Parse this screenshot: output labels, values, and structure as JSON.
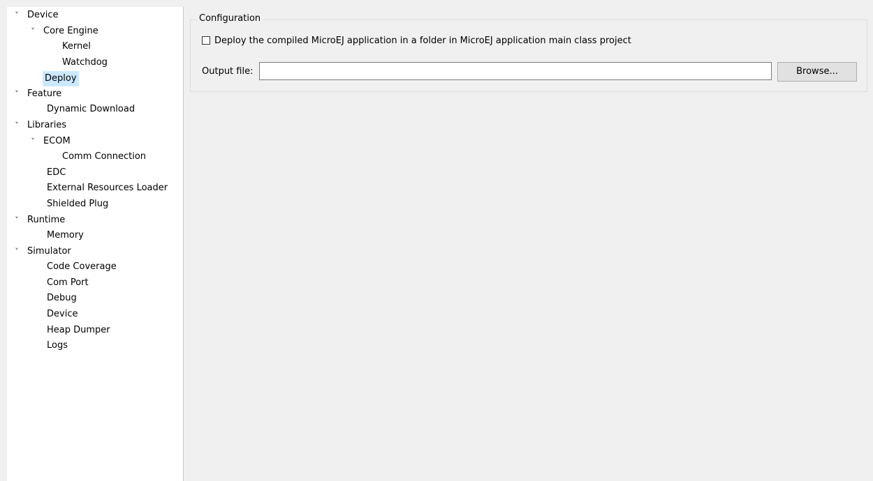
{
  "tree": {
    "items": [
      {
        "label": "Device",
        "chevron": "˅"
      },
      {
        "label": "Core Engine",
        "chevron": "˅"
      },
      {
        "label": "Kernel",
        "chevron": ""
      },
      {
        "label": "Watchdog",
        "chevron": ""
      },
      {
        "label": "Deploy",
        "chevron": ""
      },
      {
        "label": "Feature",
        "chevron": "˅"
      },
      {
        "label": "Dynamic Download",
        "chevron": ""
      },
      {
        "label": "Libraries",
        "chevron": "˅"
      },
      {
        "label": "ECOM",
        "chevron": "˅"
      },
      {
        "label": "Comm Connection",
        "chevron": ""
      },
      {
        "label": "EDC",
        "chevron": ""
      },
      {
        "label": "External Resources Loader",
        "chevron": ""
      },
      {
        "label": "Shielded Plug",
        "chevron": ""
      },
      {
        "label": "Runtime",
        "chevron": "˅"
      },
      {
        "label": "Memory",
        "chevron": ""
      },
      {
        "label": "Simulator",
        "chevron": "˅"
      },
      {
        "label": "Code Coverage",
        "chevron": ""
      },
      {
        "label": "Com Port",
        "chevron": ""
      },
      {
        "label": "Debug",
        "chevron": ""
      },
      {
        "label": "Device",
        "chevron": ""
      },
      {
        "label": "Heap Dumper",
        "chevron": ""
      },
      {
        "label": "Logs",
        "chevron": ""
      }
    ],
    "selected": "Deploy",
    "selection_color": "#cce8ff"
  },
  "config": {
    "group_title": "Configuration",
    "checkbox_label": "Deploy the compiled MicroEJ application in a folder in MicroEJ application main class project",
    "checkbox_checked": false,
    "output_label": "Output file:",
    "output_value": "",
    "browse_label": "Browse..."
  }
}
